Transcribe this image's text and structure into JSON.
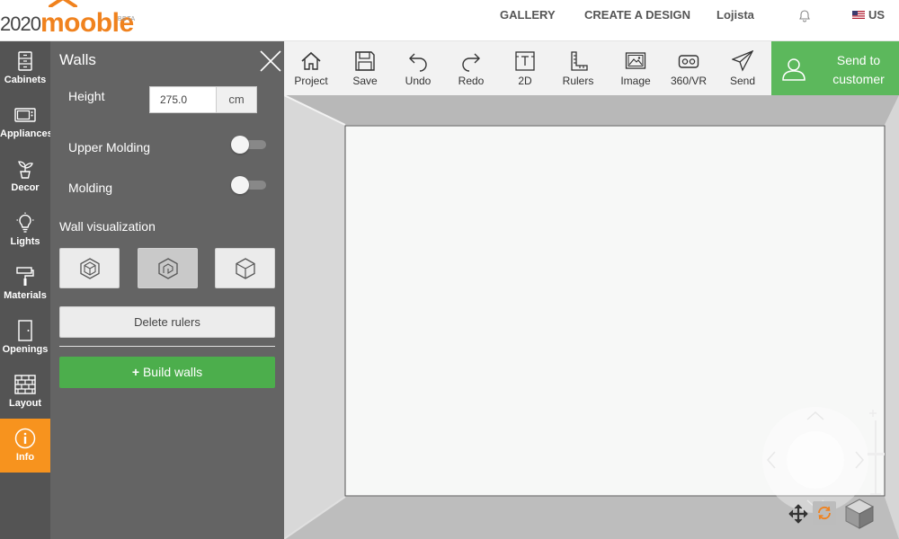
{
  "brand": {
    "logo_num": "2020",
    "logo_word": "mooble",
    "logo_tag": "BETA",
    "accent": "#f0821e"
  },
  "topnav": {
    "gallery": "GALLERY",
    "create": "CREATE A DESIGN",
    "user": "Lojista",
    "lang": "US"
  },
  "sidebar": {
    "items": [
      {
        "label": "Cabinets",
        "icon": "cabinet-icon"
      },
      {
        "label": "Appliances",
        "icon": "microwave-icon"
      },
      {
        "label": "Decor",
        "icon": "plant-icon"
      },
      {
        "label": "Lights",
        "icon": "lightbulb-icon"
      },
      {
        "label": "Materials",
        "icon": "paint-roller-icon"
      },
      {
        "label": "Openings",
        "icon": "door-icon"
      },
      {
        "label": "Layout",
        "icon": "brick-wall-icon"
      },
      {
        "label": "Info",
        "icon": "info-icon"
      }
    ],
    "active": "Info"
  },
  "walls_panel": {
    "title": "Walls",
    "height_label": "Height",
    "height_value": "275.0",
    "height_unit": "cm",
    "upper_molding_label": "Upper Molding",
    "upper_molding_on": false,
    "molding_label": "Molding",
    "molding_on": false,
    "viz_label": "Wall visualization",
    "viz_selected": 1,
    "delete_rulers": "Delete rulers",
    "build_walls": "Build walls"
  },
  "toolbar": {
    "items": [
      {
        "label": "Project",
        "icon": "house-icon"
      },
      {
        "label": "Save",
        "icon": "floppy-icon"
      },
      {
        "label": "Undo",
        "icon": "undo-icon"
      },
      {
        "label": "Redo",
        "icon": "redo-icon"
      },
      {
        "label": "2D",
        "icon": "plan-2d-icon"
      },
      {
        "label": "Rulers",
        "icon": "ruler-icon"
      },
      {
        "label": "Image",
        "icon": "image-icon"
      },
      {
        "label": "360/VR",
        "icon": "vr-headset-icon"
      },
      {
        "label": "Send",
        "icon": "paper-plane-icon"
      }
    ],
    "send_customer_line1": "Send to",
    "send_customer_line2": "customer"
  },
  "colors": {
    "panel_bg": "#646464",
    "iconbar_bg": "#545454",
    "active_orange": "#f7931e",
    "green": "#4cae4c",
    "send_green": "#5cb85c"
  }
}
